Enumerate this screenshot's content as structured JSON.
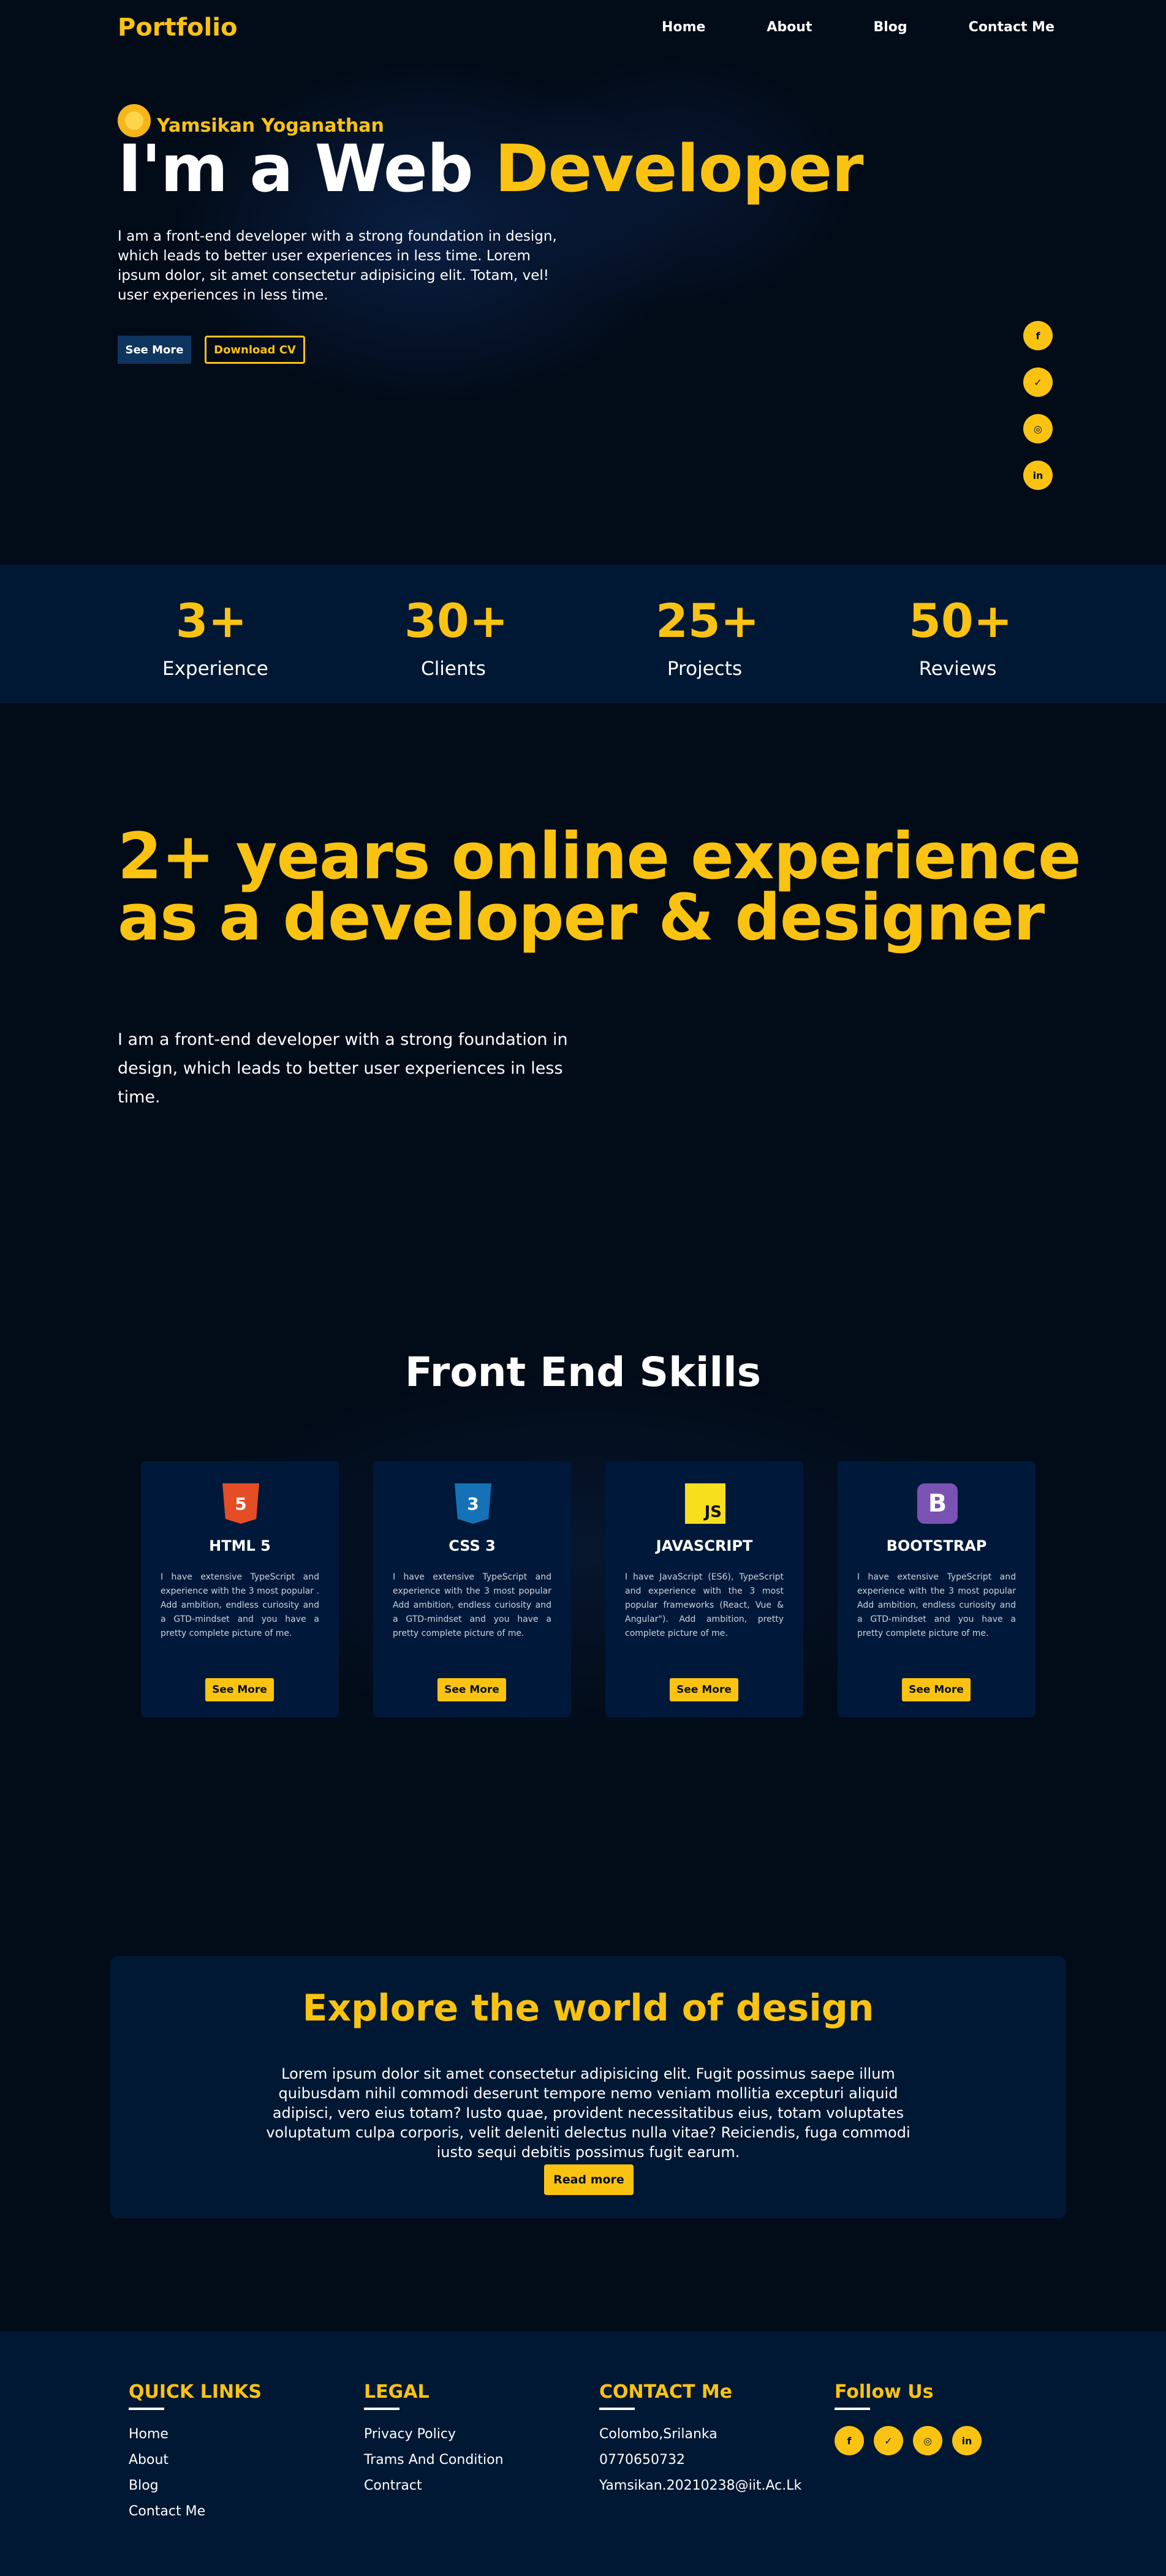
{
  "nav": {
    "logo": "Portfolio",
    "links": [
      "Home",
      "About",
      "Blog",
      "Contact Me"
    ]
  },
  "hero": {
    "badge_icon": "sunflower-badge-icon",
    "name": "Yamsikan Yoganathan",
    "title_prefix": "I'm a Web ",
    "title_highlight": "Developer",
    "description": "I am a front-end developer with a strong foundation in design, which leads to better user experiences in less time. Lorem ipsum dolor, sit amet consectetur adipisicing elit. Totam, vel! user experiences in less time.",
    "see_more": "See More",
    "download_cv": "Download CV",
    "socials": [
      {
        "icon": "facebook-icon",
        "glyph": "f"
      },
      {
        "icon": "twitter-icon",
        "glyph": "✓"
      },
      {
        "icon": "instagram-icon",
        "glyph": "◎"
      },
      {
        "icon": "linkedin-icon",
        "glyph": "in"
      }
    ]
  },
  "stats": [
    {
      "value": "3+",
      "label": "Experience"
    },
    {
      "value": "30+",
      "label": "Clients"
    },
    {
      "value": "25+",
      "label": "Projects"
    },
    {
      "value": "50+",
      "label": "Reviews"
    }
  ],
  "experience": {
    "title": "2+ years online experience as a developer & designer",
    "description": "I am a front-end developer with a strong foundation in design, which leads to better user experiences in less time."
  },
  "skills": {
    "title": "Front End Skills",
    "cards": [
      {
        "icon": "html5-icon",
        "glyph": "5",
        "color": "#e44d26",
        "title": "HTML 5",
        "text": "I have extensive TypeScript and experience with the 3 most popular . Add ambition, endless curiosity and a GTD-mindset and you have a pretty complete picture of me.",
        "button": "See More"
      },
      {
        "icon": "css3-icon",
        "glyph": "3",
        "color": "#1572b6",
        "title": "CSS 3",
        "text": "I have extensive TypeScript and experience with the 3 most popular Add ambition, endless curiosity and a GTD-mindset and you have a pretty complete picture of me.",
        "button": "See More"
      },
      {
        "icon": "javascript-icon",
        "glyph": "JS",
        "color": "#f7df1e",
        "title": "JAVASCRIPT",
        "text": "I have JavaScript (ES6), TypeScript and experience with the 3 most popular frameworks (React, Vue & Angular\"). Add ambition, pretty complete picture of me.",
        "button": "See More"
      },
      {
        "icon": "bootstrap-icon",
        "glyph": "B",
        "color": "#7952b3",
        "title": "BOOTSTRAP",
        "text": "I have extensive TypeScript and experience with the 3 most popular Add ambition, endless curiosity and a GTD-mindset and you have a pretty complete picture of me.",
        "button": "See More"
      }
    ]
  },
  "explore": {
    "title": "Explore the world of design",
    "text": "Lorem ipsum dolor sit amet consectetur adipisicing elit. Fugit possimus saepe illum quibusdam nihil commodi deserunt tempore nemo veniam mollitia excepturi aliquid adipisci, vero eius totam? Iusto quae, provident necessitatibus eius, totam voluptates voluptatum culpa corporis, velit deleniti delectus nulla vitae? Reiciendis, fuga commodi iusto sequi debitis possimus fugit earum.",
    "button": "Read more"
  },
  "footer": {
    "quick_links": {
      "title": "QUICK LINKS",
      "items": [
        "Home",
        "About",
        "Blog",
        "Contact Me"
      ]
    },
    "legal": {
      "title": "LEGAL",
      "items": [
        "Privacy Policy",
        "Trams And Condition",
        "Contract"
      ]
    },
    "contact": {
      "title": "CONTACT Me",
      "items": [
        "Colombo,Srilanka",
        "0770650732",
        "Yamsikan.20210238@iit.Ac.Lk"
      ]
    },
    "follow": {
      "title": "Follow Us",
      "socials": [
        {
          "icon": "facebook-icon",
          "glyph": "f"
        },
        {
          "icon": "twitter-icon",
          "glyph": "✓"
        },
        {
          "icon": "instagram-icon",
          "glyph": "◎"
        },
        {
          "icon": "linkedin-icon",
          "glyph": "in"
        }
      ]
    }
  },
  "colors": {
    "accent": "#fbc311",
    "background": "#020b18",
    "panel": "#001833"
  }
}
